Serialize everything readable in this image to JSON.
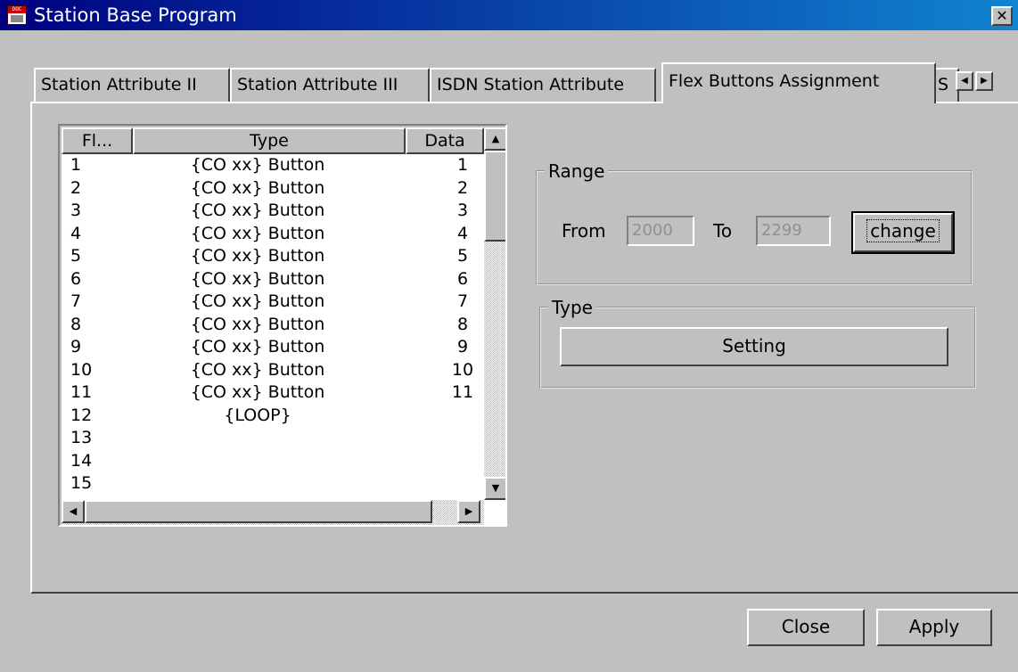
{
  "window": {
    "title": "Station Base Program",
    "icon_text": "DOC",
    "close_symbol": "✕"
  },
  "tabs": [
    {
      "label": "Station Attribute II"
    },
    {
      "label": "Station Attribute III"
    },
    {
      "label": "ISDN Station Attribute"
    },
    {
      "label": "Flex Buttons Assignment",
      "selected": true
    },
    {
      "label": "S"
    }
  ],
  "list": {
    "columns": [
      "Fl...",
      "Type",
      "Data"
    ],
    "rows": [
      [
        "1",
        "{CO xx} Button",
        "1"
      ],
      [
        "2",
        "{CO xx} Button",
        "2"
      ],
      [
        "3",
        "{CO xx} Button",
        "3"
      ],
      [
        "4",
        "{CO xx} Button",
        "4"
      ],
      [
        "5",
        "{CO xx} Button",
        "5"
      ],
      [
        "6",
        "{CO xx} Button",
        "6"
      ],
      [
        "7",
        "{CO xx} Button",
        "7"
      ],
      [
        "8",
        "{CO xx} Button",
        "8"
      ],
      [
        "9",
        "{CO xx} Button",
        "9"
      ],
      [
        "10",
        "{CO xx} Button",
        "10"
      ],
      [
        "11",
        "{CO xx} Button",
        "11"
      ],
      [
        "12",
        "{LOOP}",
        ""
      ],
      [
        "13",
        "",
        ""
      ],
      [
        "14",
        "",
        ""
      ],
      [
        "15",
        "",
        ""
      ]
    ]
  },
  "range": {
    "legend": "Range",
    "from_label": "From",
    "from_value": "2000",
    "to_label": "To",
    "to_value": "2299",
    "change_label": "change"
  },
  "type_group": {
    "legend": "Type",
    "setting_label": "Setting"
  },
  "footer": {
    "close_label": "Close",
    "apply_label": "Apply"
  },
  "colors": {
    "titlebar_start": "#000080",
    "titlebar_end": "#1084d0",
    "face": "#c0c0c0",
    "disabled_text": "#909090"
  }
}
